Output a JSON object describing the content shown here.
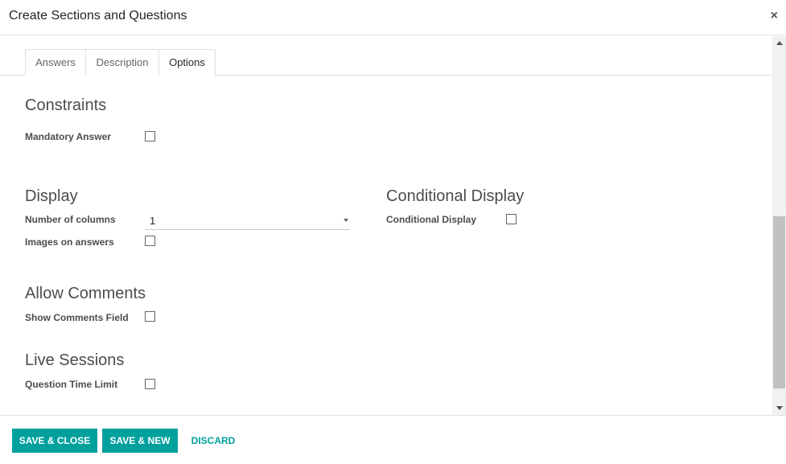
{
  "dialog": {
    "title": "Create Sections and Questions",
    "close_glyph": "×"
  },
  "tabs": [
    {
      "label": "Answers",
      "active": false
    },
    {
      "label": "Description",
      "active": false
    },
    {
      "label": "Options",
      "active": true
    }
  ],
  "constraints": {
    "heading": "Constraints",
    "mandatory_answer": {
      "label": "Mandatory Answer",
      "checked": false
    }
  },
  "display": {
    "heading": "Display",
    "number_of_columns": {
      "label": "Number of columns",
      "value": "1"
    },
    "images_on_answers": {
      "label": "Images on answers",
      "checked": false
    }
  },
  "conditional_display": {
    "heading": "Conditional Display",
    "field": {
      "label": "Conditional Display",
      "checked": false
    }
  },
  "allow_comments": {
    "heading": "Allow Comments",
    "show_comments_field": {
      "label": "Show Comments Field",
      "checked": false
    }
  },
  "live_sessions": {
    "heading": "Live Sessions",
    "question_time_limit": {
      "label": "Question Time Limit",
      "checked": false
    }
  },
  "footer": {
    "save_close": "SAVE & CLOSE",
    "save_new": "SAVE & NEW",
    "discard": "DISCARD"
  },
  "colors": {
    "accent": "#00a09d",
    "text": "#4c4c4c",
    "border": "#dee2e6"
  }
}
